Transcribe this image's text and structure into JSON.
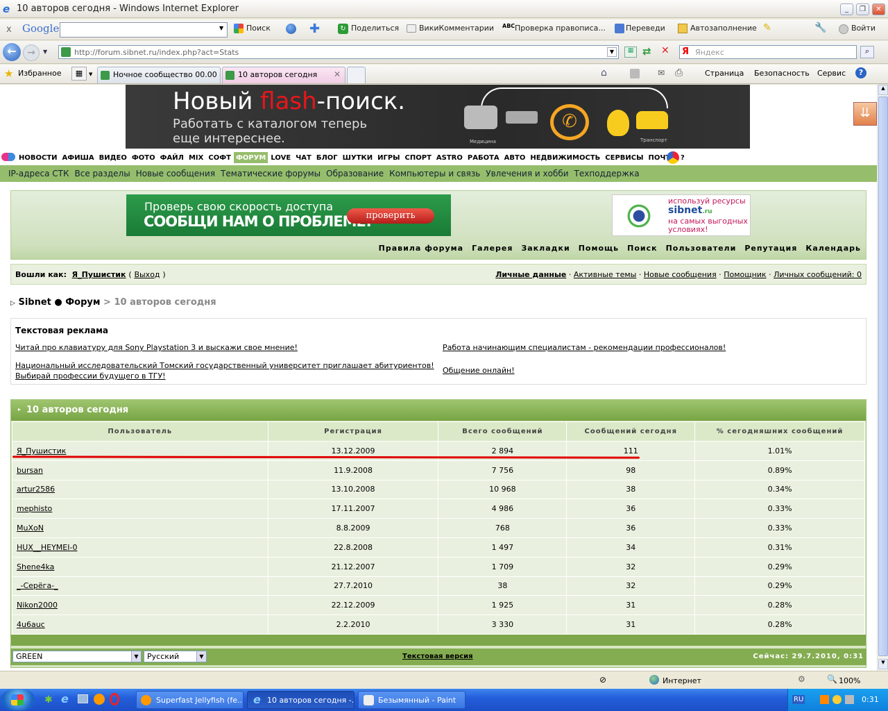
{
  "window": {
    "title": "10 авторов сегодня - Windows Internet Explorer"
  },
  "googlebar": {
    "close": "x",
    "brand": "Google",
    "search": "Поиск",
    "share": "Поделиться",
    "wikicomments": "ВикиКомментарии",
    "spell": "Проверка правописа...",
    "translate": "Переведи",
    "autofill": "Автозаполнение",
    "signin": "Войти"
  },
  "addressbar": {
    "url": "http://forum.sibnet.ru/index.php?act=Stats",
    "search_placeholder": "Яндекс"
  },
  "tabs": {
    "favorites": "Избранное",
    "tab1": "Ночное сообщество 00.00 -...",
    "tab2": "10 авторов сегодня",
    "page": "Страница",
    "security": "Безопасность",
    "service": "Сервис"
  },
  "banner": {
    "title_a": "Новый ",
    "title_b": "flash",
    "title_c": "-поиск.",
    "sub1": "Работать с каталогом теперь",
    "sub2": "еще интереснее.",
    "lab1": "Медицина",
    "lab2": "Транспорт"
  },
  "nav": [
    "НОВОСТИ",
    "АФИША",
    "ВИДЕО",
    "ФОТО",
    "ФАЙЛ",
    "MIX",
    "СОФТ",
    "ФОРУМ",
    "LOVE",
    "ЧАТ",
    "БЛОГ",
    "ШУТКИ",
    "ИГРЫ",
    "СПОРТ",
    "ASTRO",
    "РАБОТА",
    "АВТО",
    "НЕДВИЖИМОСТЬ",
    "СЕРВИСЫ",
    "ПОЧТА",
    "?"
  ],
  "subnav": [
    "IP-адреса СТК",
    "Все разделы",
    "Новые сообщения",
    "Тематические форумы",
    "Образование",
    "Компьютеры и связь",
    "Увлечения и хобби",
    "Техподдержка"
  ],
  "ads": {
    "speed1": "Проверь свою скорость доступа",
    "speed2": "СООБЩИ НАМ О ПРОБЛЕМЕ!",
    "check": "проверить",
    "sib1": "используй ресурсы",
    "sib_logo": "sibnet",
    "sib_logo_ru": ".ru",
    "sib2": "на самых выгодных",
    "sib3": "условиях!"
  },
  "forummenu": [
    "Правила форума",
    "Галерея",
    "Закладки",
    "Помощь",
    "Поиск",
    "Пользователи",
    "Репутация",
    "Календарь"
  ],
  "userbar": {
    "logged": "Вошли как:",
    "user": "Я_Пушистик",
    "open": "(",
    "logout": "Выход",
    "close": ")",
    "links": [
      "Личные данные",
      "Активные темы",
      "Новые сообщения",
      "Помощник",
      "Личных сообщений: 0"
    ]
  },
  "breadcrumb": {
    "a": "Sibnet",
    "sep": "●",
    "b": "Форум",
    "gt": ">",
    "c": "10 авторов сегодня"
  },
  "textads": {
    "title": "Текстовая реклама",
    "l1": "Читай про клавиатуру для Sony Playstation 3 и выскажи свое мнение!",
    "l2": "Национальный исследовательский Томский государственный университет приглашает абитуриентов!",
    "l2b": "Выбирай профессии будущего в ТГУ!",
    "r1": "Работа начинающим специалистам - рекомендации профессионалов!",
    "r2": "Общение онлайн!"
  },
  "stats": {
    "title": "10 авторов сегодня",
    "headers": [
      "Пользователь",
      "Регистрация",
      "Всего сообщений",
      "Сообщений сегодня",
      "% сегодняшних сообщений"
    ],
    "rows": [
      [
        "Я_Пушистик",
        "13.12.2009",
        "2 894",
        "111",
        "1.01%"
      ],
      [
        "bursan",
        "11.9.2008",
        "7 756",
        "98",
        "0.89%"
      ],
      [
        "artur2586",
        "13.10.2008",
        "10 968",
        "38",
        "0.34%"
      ],
      [
        "mephisto",
        "17.11.2007",
        "4 986",
        "36",
        "0.33%"
      ],
      [
        "MuXoN",
        "8.8.2009",
        "768",
        "36",
        "0.33%"
      ],
      [
        "HUX__HEYMEI-0",
        "22.8.2008",
        "1 497",
        "34",
        "0.31%"
      ],
      [
        "Shene4ka",
        "21.12.2007",
        "1 709",
        "32",
        "0.29%"
      ],
      [
        "_-Серёга-_",
        "27.7.2010",
        "38",
        "32",
        "0.29%"
      ],
      [
        "Nikon2000",
        "22.12.2009",
        "1 925",
        "31",
        "0.28%"
      ],
      [
        "4u6auc",
        "2.2.2010",
        "3 330",
        "31",
        "0.28%"
      ]
    ]
  },
  "footer": {
    "skin": "GREEN",
    "lang": "Русский",
    "textver": "Текстовая версия",
    "now": "Сейчас: 29.7.2010, 0:31"
  },
  "status": {
    "zone": "Интернет",
    "zoom": "100%"
  },
  "taskbar": {
    "t1": "Superfast Jellyfish (fe...",
    "t2": "10 авторов сегодня -...",
    "t3": "Безымянный - Paint",
    "lang": "RU",
    "clock": "0:31"
  },
  "colors": {
    "forum_green": "#96bd6b",
    "header_green": "#6f9a3a",
    "highlight_red": "#e00000"
  }
}
